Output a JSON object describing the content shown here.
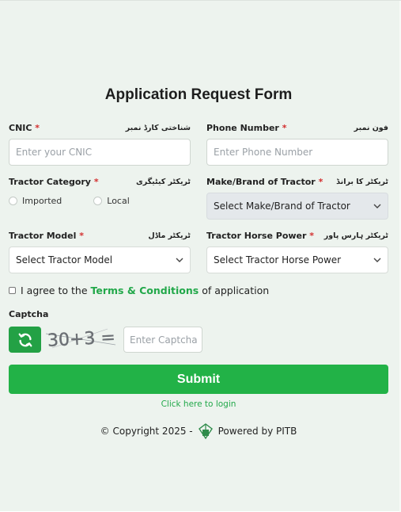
{
  "form": {
    "title": "Application Request Form",
    "required_marker": "*",
    "cnic": {
      "label": "CNIC",
      "urdu_label": "شناختی کارڈ نمبر",
      "placeholder": "Enter your CNIC"
    },
    "phone": {
      "label": "Phone Number",
      "urdu_label": "فون نمبر",
      "placeholder": "Enter Phone Number"
    },
    "category": {
      "label": "Tractor Category",
      "urdu_label": "ٹریکٹر کیٹیگری",
      "options": [
        "Imported",
        "Local"
      ]
    },
    "make": {
      "label": "Make/Brand of Tractor",
      "urdu_label": "ٹریکٹر کا برانڈ",
      "value": "Select Make/Brand of Tractor"
    },
    "model": {
      "label": "Tractor Model",
      "urdu_label": "ٹریکٹر ماڈل",
      "value": "Select Tractor Model"
    },
    "horsepower": {
      "label": "Tractor Horse Power",
      "urdu_label": "ٹریکٹر ہارس پاور",
      "value": "Select Tractor Horse Power"
    },
    "agree": {
      "prefix": "I agree to the",
      "link": "Terms & Conditions",
      "suffix": "of application"
    },
    "captcha": {
      "label": "Captcha",
      "text": "30+3 =",
      "placeholder": "Enter Captcha"
    },
    "submit_label": "Submit",
    "login_link": "Click here to login"
  },
  "footer": {
    "copyright": "© Copyright 2025 -",
    "powered": "Powered by PITB"
  },
  "colors": {
    "accent": "#22b247",
    "refresh": "#23a145",
    "background": "#edf3ee",
    "required": "#d32f2f"
  }
}
